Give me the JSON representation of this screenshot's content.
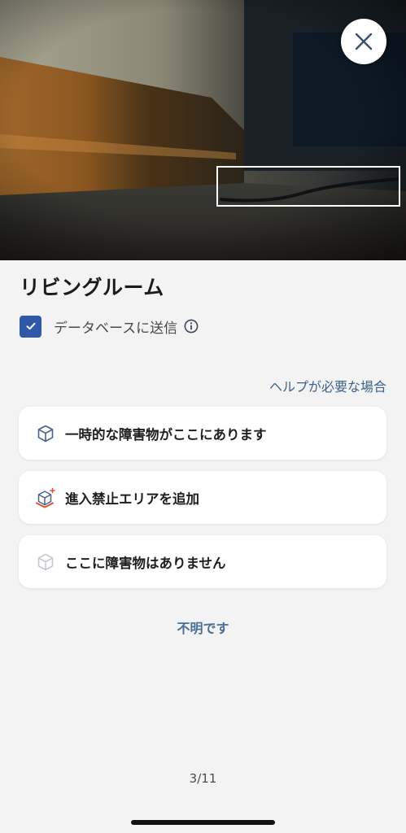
{
  "room_name": "リビングルーム",
  "database": {
    "label": "データベースに送信",
    "checked": true
  },
  "help_link": "ヘルプが必要な場合",
  "options": [
    {
      "label": "一時的な障害物がここにあります",
      "icon": "cube-outline-icon"
    },
    {
      "label": "進入禁止エリアを追加",
      "icon": "no-go-zone-cube-icon"
    },
    {
      "label": "ここに障害物はありません",
      "icon": "cube-faded-icon"
    }
  ],
  "unknown_link": "不明です",
  "pager": "3/11",
  "colors": {
    "accent": "#2f58a8",
    "link": "#3f6289",
    "background": "#f3f3f3",
    "no_go_zone": "#e0522c"
  }
}
